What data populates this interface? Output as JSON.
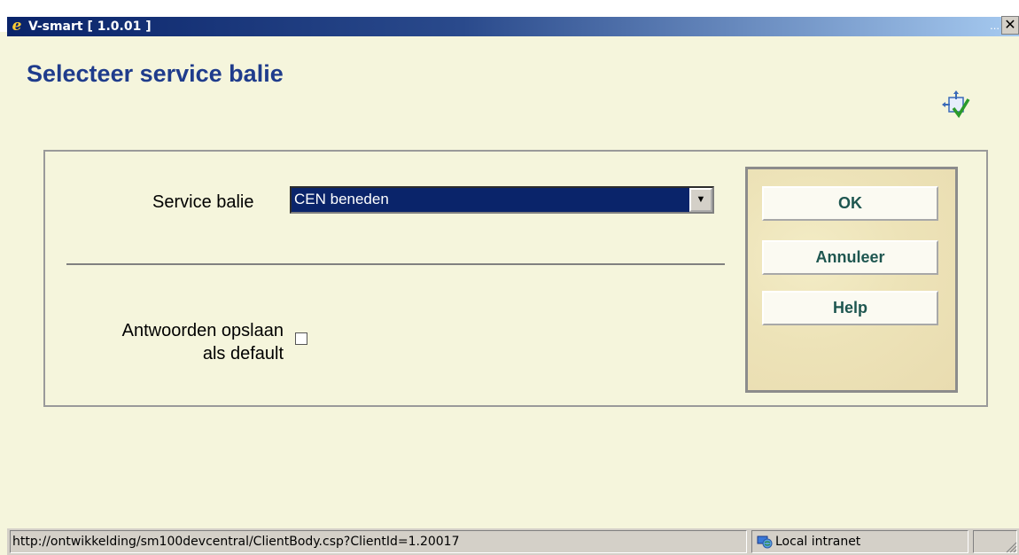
{
  "window": {
    "title": "V-smart [ 1.0.01 ]",
    "minimize_glyph": "...",
    "close_glyph": "✕"
  },
  "page": {
    "title": "Selecteer service balie",
    "corner_icon": "exit-check-icon"
  },
  "form": {
    "service_label": "Service balie",
    "service_value": "CEN beneden",
    "save_default_label_line1": "Antwoorden opslaan",
    "save_default_label_line2": "als default",
    "save_default_checked": false
  },
  "buttons": {
    "ok": "OK",
    "cancel": "Annuleer",
    "help": "Help"
  },
  "statusbar": {
    "url": "http://ontwikkelding/sm100devcentral/ClientBody.csp?ClientId=1.20017",
    "zone": "Local intranet",
    "zone_icon": "globe-network-icon"
  },
  "colors": {
    "title_text": "#1f3c8c",
    "background": "#f5f5dc",
    "button_text": "#1e5650",
    "selection": "#0a246a"
  }
}
